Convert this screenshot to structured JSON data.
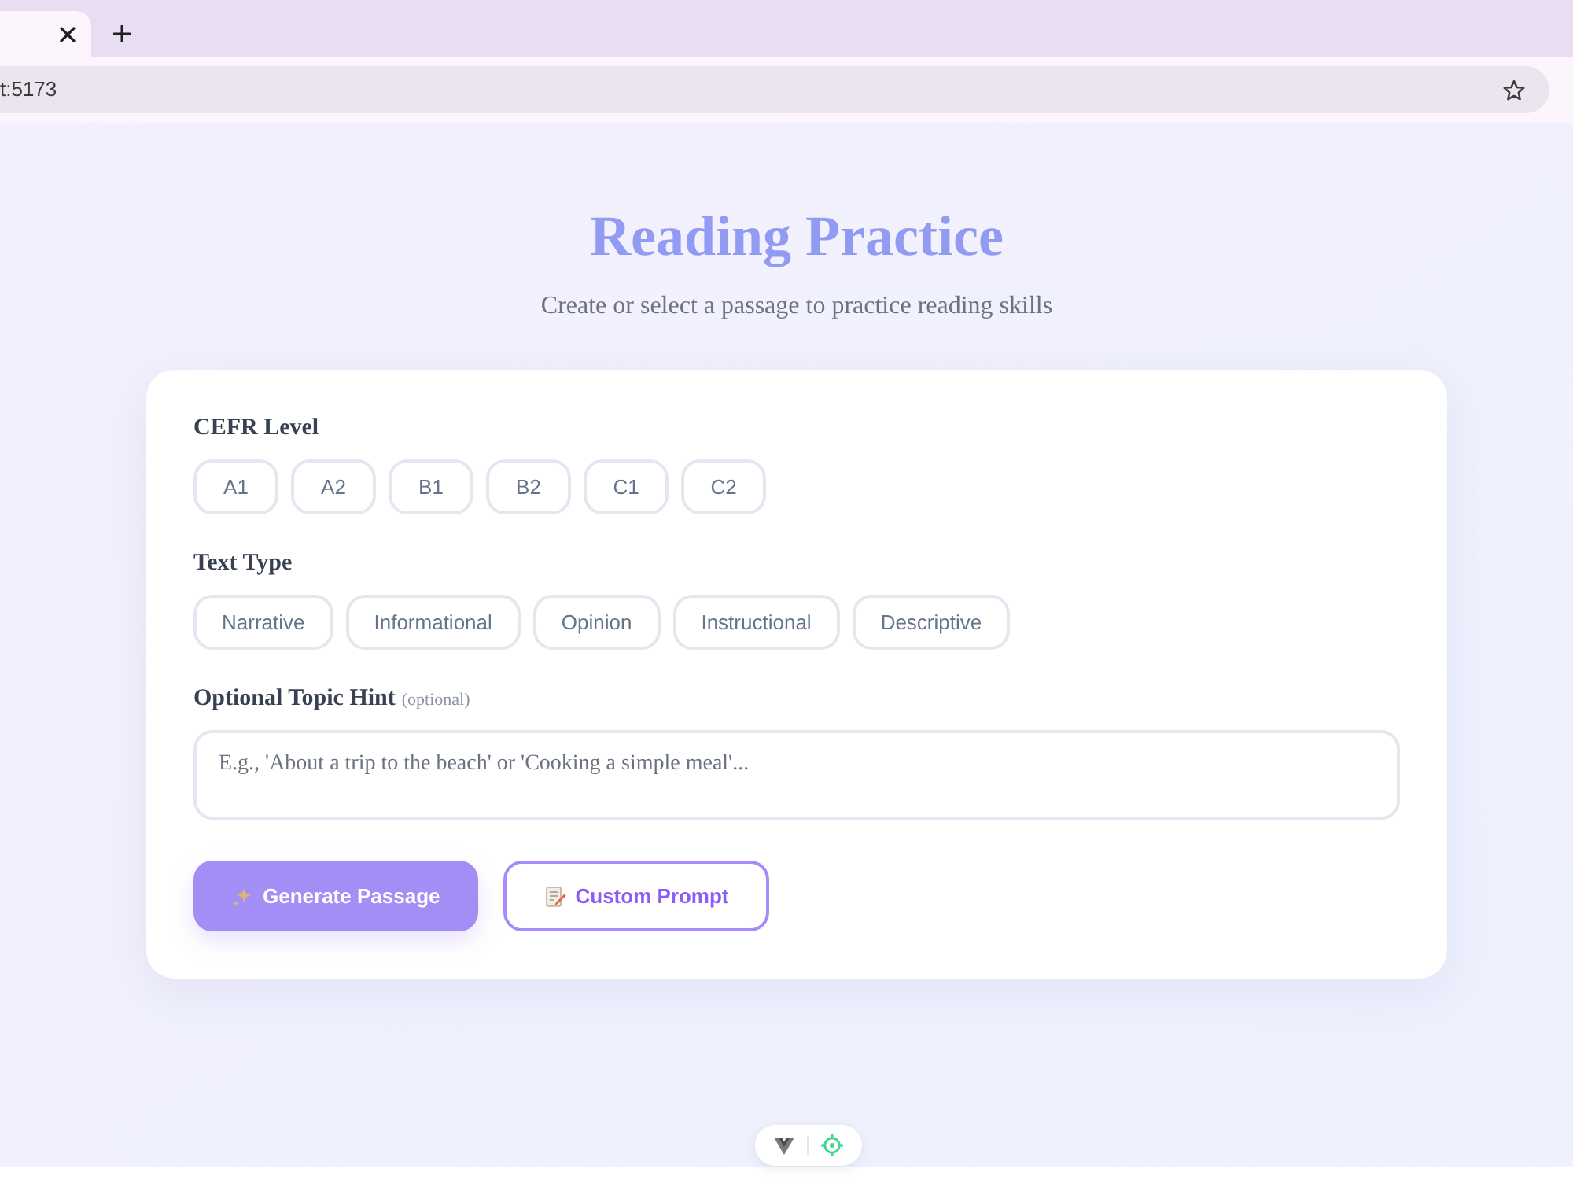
{
  "browser": {
    "url": "t:5173"
  },
  "header": {
    "title": "Reading Practice",
    "subtitle": "Create or select a passage to practice reading skills"
  },
  "form": {
    "level": {
      "label": "CEFR Level",
      "options": [
        {
          "label": "A1",
          "selected": false
        },
        {
          "label": "A2",
          "selected": false
        },
        {
          "label": "B1",
          "selected": false
        },
        {
          "label": "B2",
          "selected": false
        },
        {
          "label": "C1",
          "selected": false
        },
        {
          "label": "C2",
          "selected": false
        }
      ]
    },
    "text_type": {
      "label": "Text Type",
      "options": [
        {
          "label": "Narrative",
          "selected": false
        },
        {
          "label": "Informational",
          "selected": false
        },
        {
          "label": "Opinion",
          "selected": false
        },
        {
          "label": "Instructional",
          "selected": false
        },
        {
          "label": "Descriptive",
          "selected": false
        }
      ]
    },
    "topic": {
      "label": "Optional Topic Hint",
      "note": "(optional)",
      "placeholder": "E.g., 'About a trip to the beach' or 'Cooking a simple meal'..."
    },
    "actions": [
      {
        "kind": "primary",
        "label": "Generate Passage",
        "disabled": true
      },
      {
        "kind": "outline",
        "label": "Custom Prompt",
        "disabled": false
      }
    ]
  }
}
